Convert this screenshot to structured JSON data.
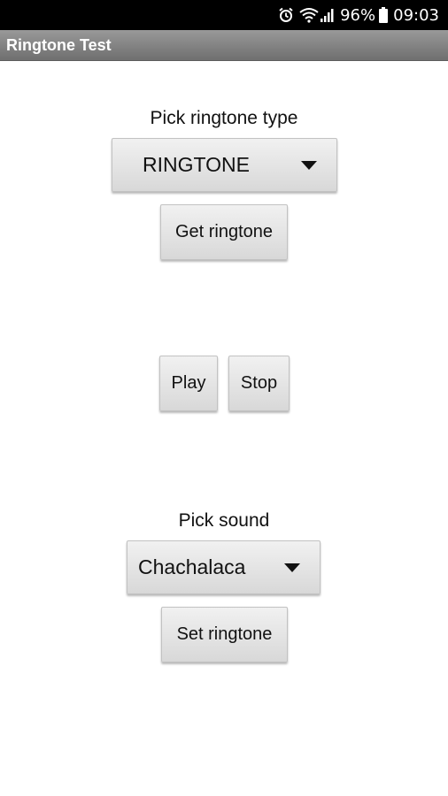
{
  "status_bar": {
    "battery_percent": "96%",
    "time": "09:03",
    "icons": [
      "alarm-icon",
      "wifi-icon",
      "signal-icon",
      "battery-icon"
    ]
  },
  "app": {
    "title": "Ringtone Test"
  },
  "ringtone_type": {
    "label": "Pick ringtone type",
    "selected": "RINGTONE",
    "get_button_label": "Get ringtone"
  },
  "playback": {
    "play_label": "Play",
    "stop_label": "Stop"
  },
  "sound": {
    "label": "Pick sound",
    "selected": "Chachalaca",
    "set_button_label": "Set ringtone"
  }
}
